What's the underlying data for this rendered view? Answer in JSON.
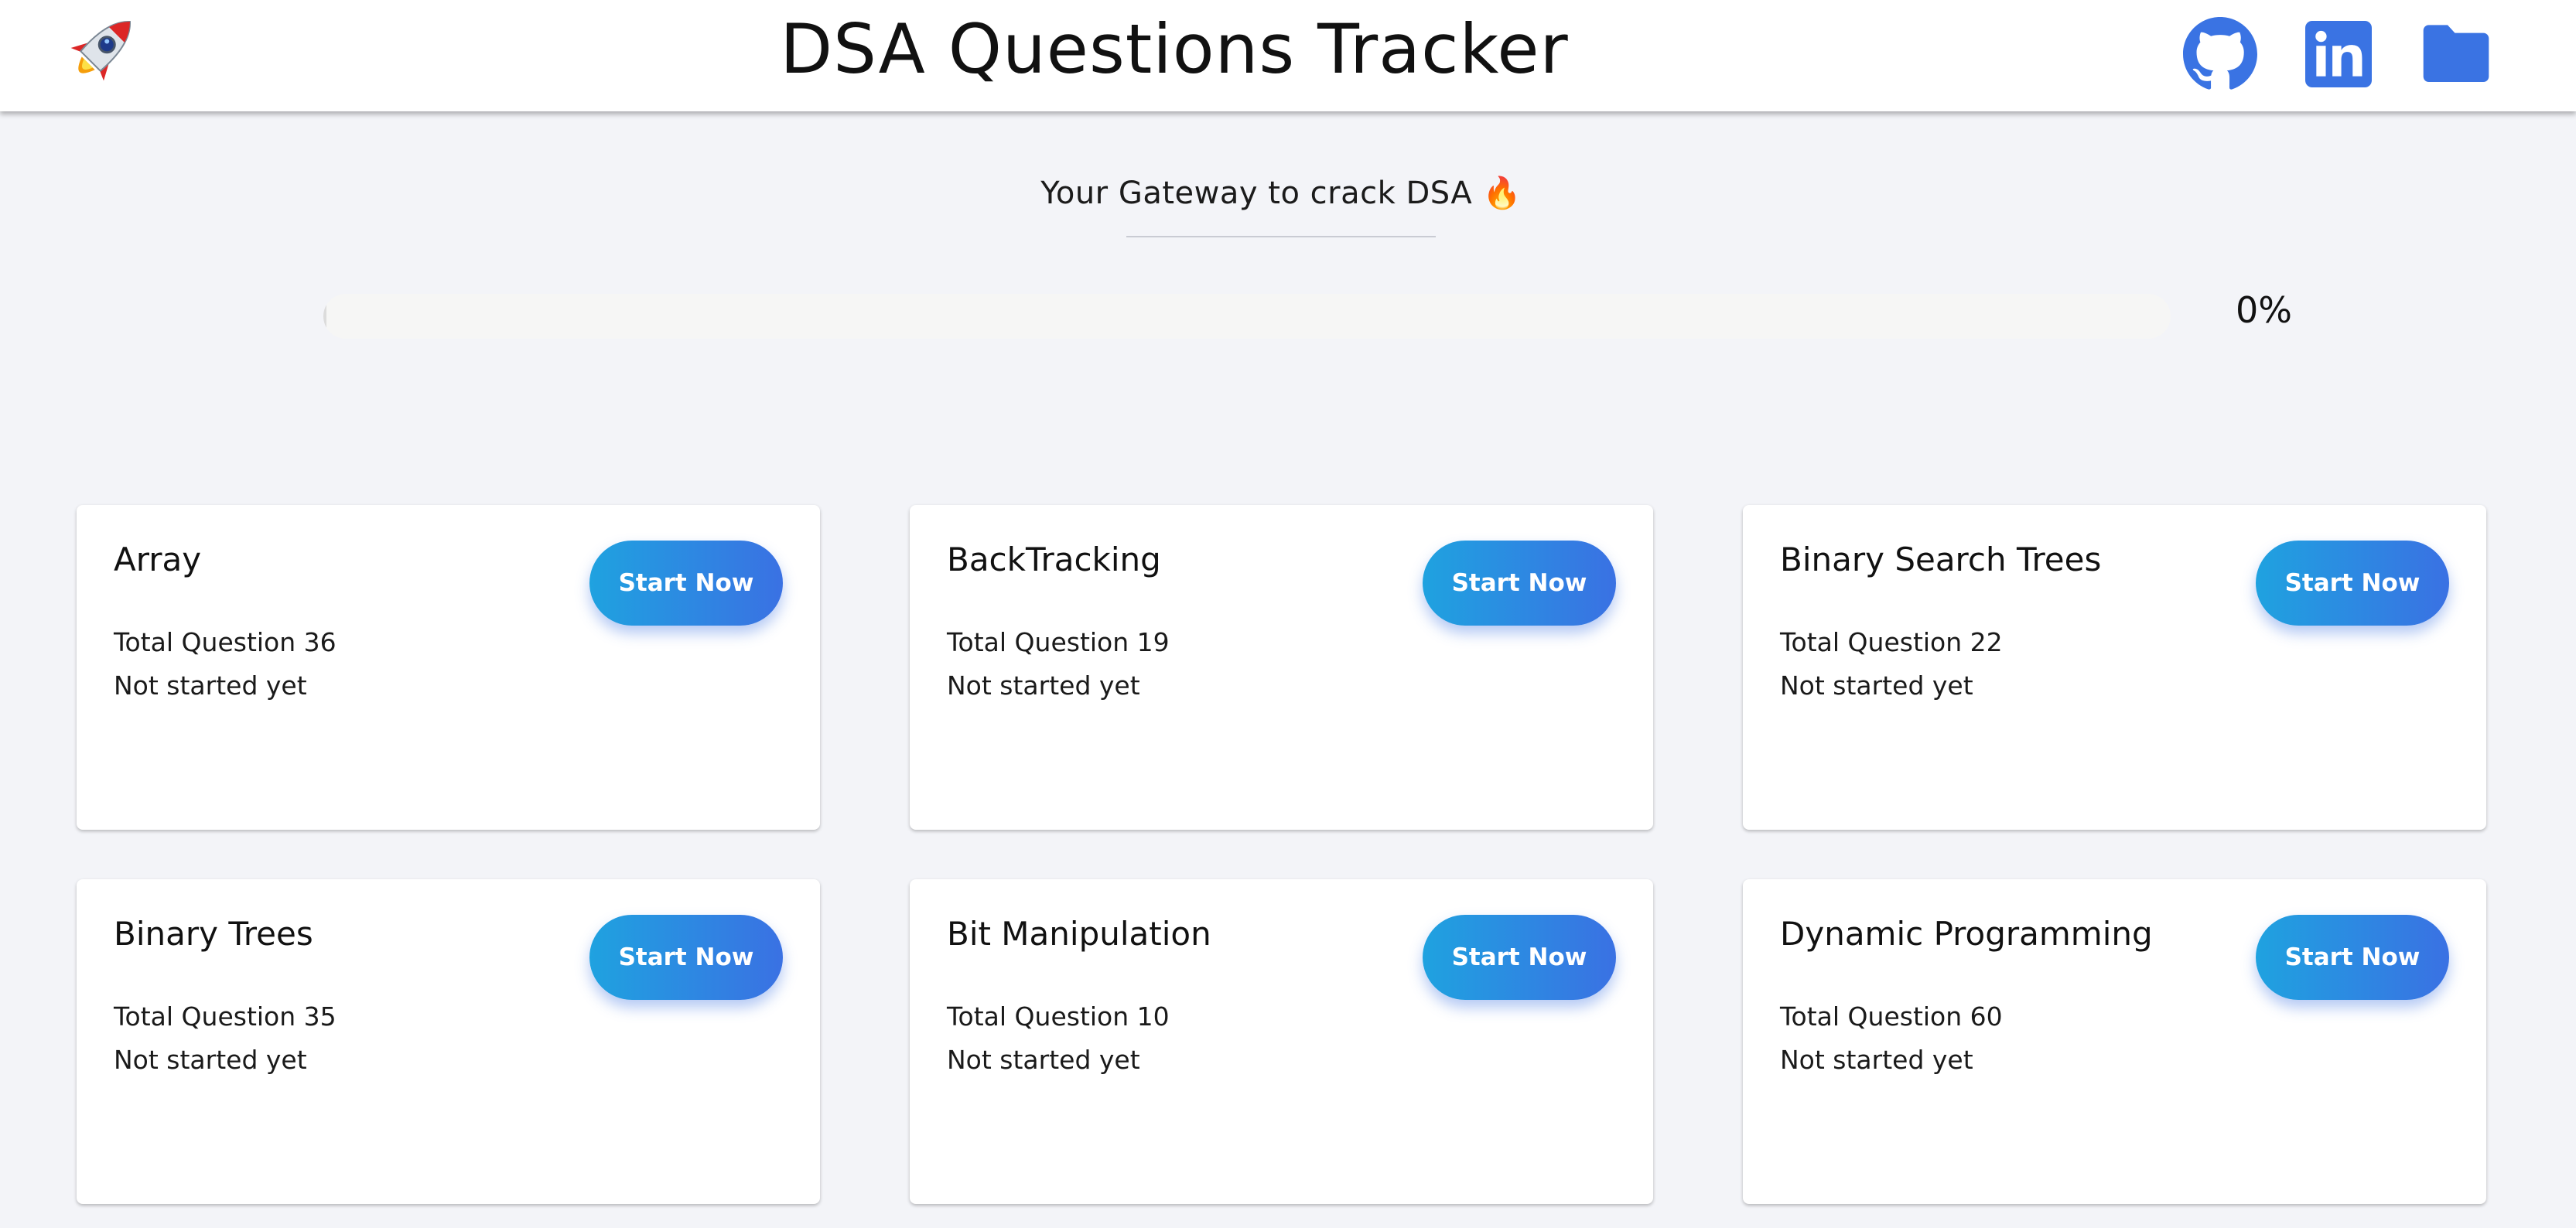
{
  "header": {
    "title": "DSA Questions Tracker",
    "logo_icon": "rocket-icon",
    "links": [
      {
        "icon": "github-icon"
      },
      {
        "icon": "linkedin-icon"
      },
      {
        "icon": "folder-icon"
      }
    ]
  },
  "hero": {
    "subtitle": "Your Gateway to crack DSA 🔥"
  },
  "progress": {
    "value": 0,
    "label": "0%"
  },
  "topics": [
    {
      "name": "Array",
      "total": "Total Question 36",
      "status": "Not started yet",
      "button": "Start Now"
    },
    {
      "name": "BackTracking",
      "total": "Total Question 19",
      "status": "Not started yet",
      "button": "Start Now"
    },
    {
      "name": "Binary Search Trees",
      "total": "Total Question 22",
      "status": "Not started yet",
      "button": "Start Now"
    },
    {
      "name": "Binary Trees",
      "total": "Total Question 35",
      "status": "Not started yet",
      "button": "Start Now"
    },
    {
      "name": "Bit Manipulation",
      "total": "Total Question 10",
      "status": "Not started yet",
      "button": "Start Now"
    },
    {
      "name": "Dynamic Programming",
      "total": "Total Question 60",
      "status": "Not started yet",
      "button": "Start Now"
    }
  ],
  "colors": {
    "accent_start": "#1fa2e0",
    "accent_end": "#3a71e3",
    "icon_blue": "#3a73e3",
    "background": "#f3f4f8"
  }
}
